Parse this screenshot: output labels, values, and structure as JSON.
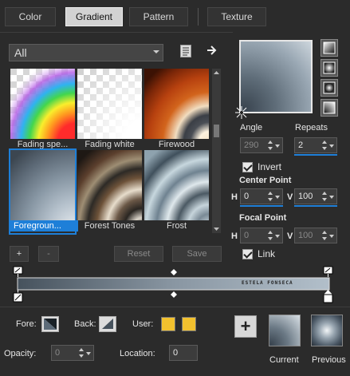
{
  "tabs": [
    {
      "label": "Color"
    },
    {
      "label": "Gradient"
    },
    {
      "label": "Pattern"
    },
    {
      "label": "Texture"
    }
  ],
  "category": {
    "value": "All"
  },
  "thumbnails": [
    {
      "label": "Fading spe..."
    },
    {
      "label": "Fading white"
    },
    {
      "label": "Firewood"
    },
    {
      "label": "Foregroun..."
    },
    {
      "label": "Forest Tones"
    },
    {
      "label": "Frost"
    }
  ],
  "buttons": {
    "add": "+",
    "remove": "-",
    "reset": "Reset",
    "save": "Save"
  },
  "angle": {
    "label": "Angle",
    "value": "290"
  },
  "repeats": {
    "label": "Repeats",
    "value": "2"
  },
  "invert": {
    "label": "Invert",
    "checked": true
  },
  "center_point": {
    "title": "Center Point",
    "h_label": "H",
    "h_value": "0",
    "v_label": "V",
    "v_value": "100"
  },
  "focal_point": {
    "title": "Focal Point",
    "h_label": "H",
    "h_value": "0",
    "v_label": "V",
    "v_value": "100"
  },
  "link": {
    "label": "Link",
    "checked": true
  },
  "gradient_bar": {
    "watermark": "ESTELA FONSECA"
  },
  "bottom": {
    "fore_label": "Fore:",
    "back_label": "Back:",
    "user_label": "User:",
    "user_colors": [
      "#f2c12e",
      "#f2c12e"
    ],
    "opacity_label": "Opacity:",
    "opacity_value": "0",
    "location_label": "Location:",
    "location_value": "0",
    "add_symbol": "+",
    "current_label": "Current",
    "previous_label": "Previous"
  },
  "colors": {
    "accent": "#1e7fd8",
    "background": "#2b2b2b"
  }
}
